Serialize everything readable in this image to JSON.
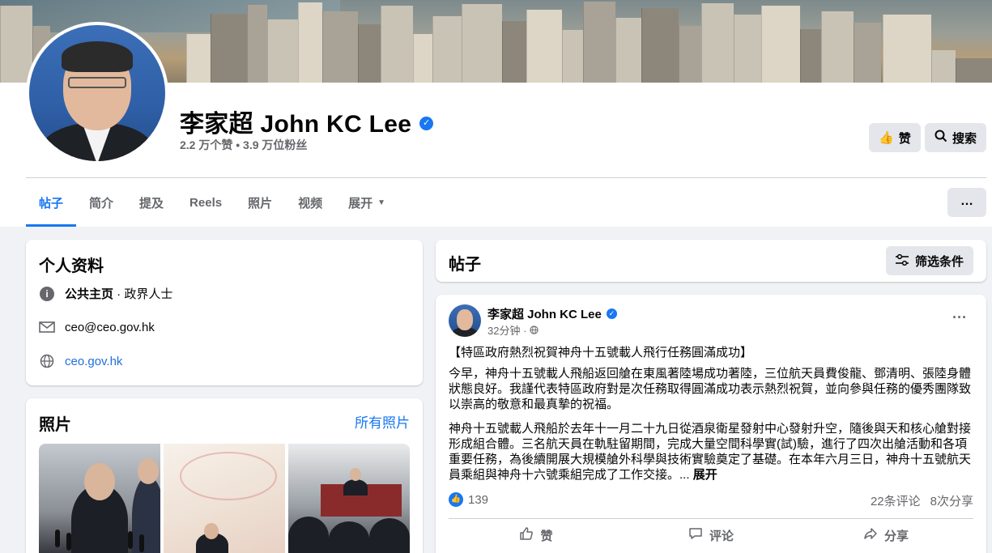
{
  "page": {
    "name": "李家超 John KC Lee",
    "stats": "2.2 万个赞 • 3.9 万位粉丝",
    "like_button": "赞",
    "search_button": "搜索",
    "more_icon": "…"
  },
  "tabs": [
    {
      "label": "帖子",
      "active": true
    },
    {
      "label": "简介"
    },
    {
      "label": "提及"
    },
    {
      "label": "Reels"
    },
    {
      "label": "照片"
    },
    {
      "label": "视频"
    },
    {
      "label": "展开"
    }
  ],
  "intro": {
    "title": "个人资料",
    "category_bold": "公共主页",
    "category_rest": " · 政界人士",
    "email": "ceo@ceo.gov.hk",
    "website": "ceo.gov.hk"
  },
  "photos": {
    "title": "照片",
    "all_link": "所有照片"
  },
  "posts_header": {
    "title": "帖子",
    "filter_button": "筛选条件"
  },
  "post": {
    "author": "李家超 John KC Lee",
    "time": "32分钟 · ",
    "headline": "【特區政府熱烈祝賀神舟十五號載人飛行任務圓滿成功】",
    "para1": "今早，神舟十五號載人飛船返回艙在東風著陸場成功著陸，三位航天員費俊龍、鄧清明、張陸身體狀態良好。我謹代表特區政府對是次任務取得圓滿成功表示熱烈祝賀，並向參與任務的優秀團隊致以崇高的敬意和最真摯的祝福。",
    "para2": "神舟十五號載人飛船於去年十一月二十九日從酒泉衛星發射中心發射升空，隨後與天和核心艙對接形成組合體。三名航天員在軌駐留期間，完成大量空間科學實(試)驗，進行了四次出艙活動和各項重要任務，為後續開展大規模艙外科學與技術實驗奠定了基礎。在本年六月三日，神舟十五號航天員乘組與神舟十六號乘組完成了工作交接。... ",
    "see_more": "展开",
    "likes": "139",
    "comments": "22条评论",
    "shares": "8次分享",
    "action_like": "赞",
    "action_comment": "评论",
    "action_share": "分享"
  },
  "colors": {
    "accent": "#1877f2",
    "background": "#f0f2f5",
    "secondary_text": "#65676b"
  }
}
